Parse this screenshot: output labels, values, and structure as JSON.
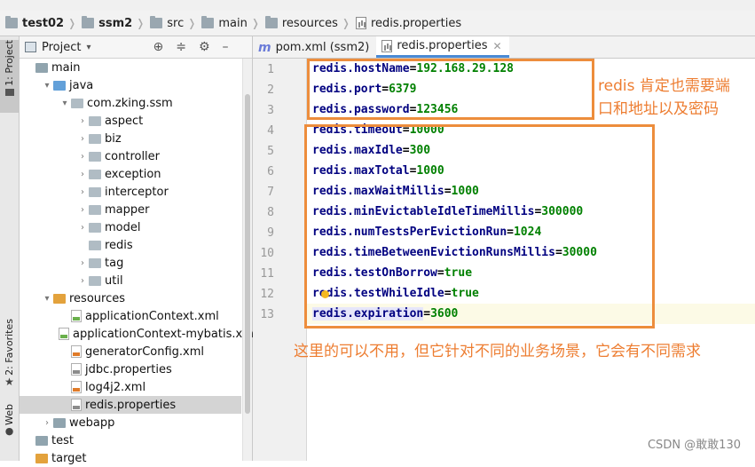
{
  "breadcrumb": [
    "test02",
    "ssm2",
    "src",
    "main",
    "resources",
    "redis.properties"
  ],
  "sidebar": {
    "project_tab": "1: Project",
    "favorites_tab": "2: Favorites",
    "web_tab": "Web"
  },
  "project_panel": {
    "title": "Project"
  },
  "tree": [
    {
      "label": "main",
      "indent": 0,
      "arrow": "",
      "icon": "folder-icon"
    },
    {
      "label": "java",
      "indent": 1,
      "arrow": "▾",
      "icon": "source-folder-icon"
    },
    {
      "label": "com.zking.ssm",
      "indent": 2,
      "arrow": "▾",
      "icon": "package-icon"
    },
    {
      "label": "aspect",
      "indent": 3,
      "arrow": "›",
      "icon": "package-icon"
    },
    {
      "label": "biz",
      "indent": 3,
      "arrow": "›",
      "icon": "package-icon"
    },
    {
      "label": "controller",
      "indent": 3,
      "arrow": "›",
      "icon": "package-icon"
    },
    {
      "label": "exception",
      "indent": 3,
      "arrow": "›",
      "icon": "package-icon"
    },
    {
      "label": "interceptor",
      "indent": 3,
      "arrow": "›",
      "icon": "package-icon"
    },
    {
      "label": "mapper",
      "indent": 3,
      "arrow": "›",
      "icon": "package-icon"
    },
    {
      "label": "model",
      "indent": 3,
      "arrow": "›",
      "icon": "package-icon"
    },
    {
      "label": "redis",
      "indent": 3,
      "arrow": "",
      "icon": "package-icon"
    },
    {
      "label": "tag",
      "indent": 3,
      "arrow": "›",
      "icon": "package-icon"
    },
    {
      "label": "util",
      "indent": 3,
      "arrow": "›",
      "icon": "package-icon"
    },
    {
      "label": "resources",
      "indent": 1,
      "arrow": "▾",
      "icon": "resources-folder-icon"
    },
    {
      "label": "applicationContext.xml",
      "indent": 2,
      "arrow": "",
      "icon": "spring-xml-icon"
    },
    {
      "label": "applicationContext-mybatis.xml",
      "indent": 2,
      "arrow": "",
      "icon": "spring-xml-icon"
    },
    {
      "label": "generatorConfig.xml",
      "indent": 2,
      "arrow": "",
      "icon": "xml-file-icon"
    },
    {
      "label": "jdbc.properties",
      "indent": 2,
      "arrow": "",
      "icon": "properties-file-icon"
    },
    {
      "label": "log4j2.xml",
      "indent": 2,
      "arrow": "",
      "icon": "xml-file-icon"
    },
    {
      "label": "redis.properties",
      "indent": 2,
      "arrow": "",
      "icon": "properties-file-icon",
      "selected": true
    },
    {
      "label": "webapp",
      "indent": 1,
      "arrow": "›",
      "icon": "folder-icon"
    },
    {
      "label": "test",
      "indent": 0,
      "arrow": "",
      "icon": "folder-icon"
    },
    {
      "label": "target",
      "indent": 0,
      "arrow": "",
      "icon": "excluded-folder-icon"
    }
  ],
  "tabs": [
    {
      "label": "pom.xml (ssm2)",
      "icon": "maven-icon",
      "active": false
    },
    {
      "label": "redis.properties",
      "icon": "properties-file-icon",
      "active": true
    }
  ],
  "editor": {
    "current_line": 13,
    "lines": [
      {
        "n": "1",
        "key": "redis.hostName",
        "value": "192.168.29.128"
      },
      {
        "n": "2",
        "key": "redis.port",
        "value": "6379"
      },
      {
        "n": "3",
        "key": "redis.password",
        "value": "123456"
      },
      {
        "n": "4",
        "key": "redis.timeout",
        "value": "10000"
      },
      {
        "n": "5",
        "key": "redis.maxIdle",
        "value": "300"
      },
      {
        "n": "6",
        "key": "redis.maxTotal",
        "value": "1000"
      },
      {
        "n": "7",
        "key": "redis.maxWaitMillis",
        "value": "1000"
      },
      {
        "n": "8",
        "key": "redis.minEvictableIdleTimeMillis",
        "value": "300000"
      },
      {
        "n": "9",
        "key": "redis.numTestsPerEvictionRun",
        "value": "1024"
      },
      {
        "n": "10",
        "key": "redis.timeBetweenEvictionRunsMillis",
        "value": "30000"
      },
      {
        "n": "11",
        "key": "redis.testOnBorrow",
        "value": "true"
      },
      {
        "n": "12",
        "key": "redis.testWhileIdle",
        "value": "true"
      },
      {
        "n": "13",
        "key": "redis.expiration",
        "value": "3600"
      }
    ]
  },
  "annotations": {
    "note1_line1": "redis 肯定也需要端",
    "note1_line2": "口和地址以及密码",
    "note2": "这里的可以不用，但它针对不同的业务场景，它会有不同需求",
    "color": "#ed7d31"
  },
  "watermark": "CSDN @敢敢130"
}
